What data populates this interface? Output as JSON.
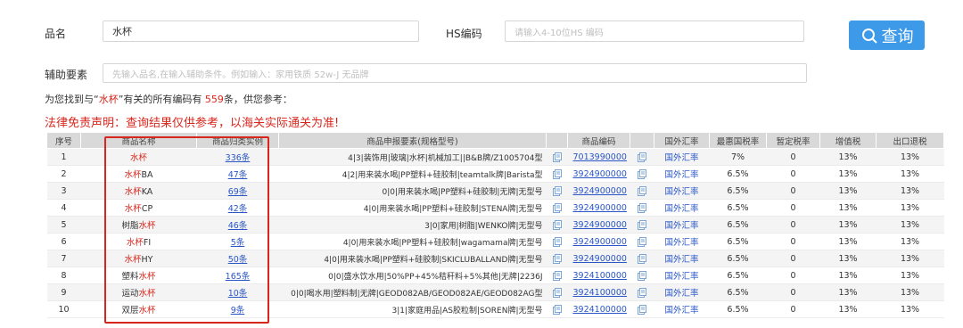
{
  "form": {
    "product_name_label": "品名",
    "product_name_value": "水杯",
    "hs_label": "HS编码",
    "hs_placeholder": "请输入4-10位HS 编码",
    "aux_label": "辅助要素",
    "aux_placeholder": "先输入品名,在输入辅助条件。例如输入：家用铁质 52w-J 无品牌",
    "search_label": "查询"
  },
  "result": {
    "prefix": "为您找到与“",
    "keyword": "水杯",
    "middle": "”有关的所有编码有",
    "count": "559",
    "suffix": "条，供您参考：",
    "disclaimer": "法律免责声明：查询结果仅供参考，以海关实际通关为准!"
  },
  "table": {
    "headers": [
      "序号",
      "商品名称",
      "商品归类实例",
      "商品申报要素(规格型号)",
      "",
      "商品编码",
      "",
      "国外汇率",
      "最惠国税率",
      "暂定税率",
      "增值税",
      "出口退税"
    ],
    "rows": [
      {
        "no": "1",
        "name_pre": "",
        "name_hl": "水杯",
        "name_post": "",
        "cases": "336条",
        "elements": "4|3|装饰用|玻璃|水杯|机械加工||B&B牌/Z1005704型",
        "code": "7013990000",
        "rate_link": "国外汇率",
        "mfn": "7%",
        "provisional": "0",
        "vat": "13%",
        "rebate": "13%"
      },
      {
        "no": "2",
        "name_pre": "",
        "name_hl": "水杯",
        "name_post": "BA",
        "cases": "47条",
        "elements": "4|2|用来装水喝|PP塑料+硅胶制|teamtalk牌|Barista型",
        "code": "3924900000",
        "rate_link": "国外汇率",
        "mfn": "6.5%",
        "provisional": "0",
        "vat": "13%",
        "rebate": "13%"
      },
      {
        "no": "3",
        "name_pre": "",
        "name_hl": "水杯",
        "name_post": "KA",
        "cases": "69条",
        "elements": "0|0|用来装水喝|PP塑料+硅胶制|无牌|无型号",
        "code": "3924900000",
        "rate_link": "国外汇率",
        "mfn": "6.5%",
        "provisional": "0",
        "vat": "13%",
        "rebate": "13%"
      },
      {
        "no": "4",
        "name_pre": "",
        "name_hl": "水杯",
        "name_post": "CP",
        "cases": "42条",
        "elements": "4|0|用来装水喝|PP塑料+硅胶制|STENA牌|无型号",
        "code": "3924900000",
        "rate_link": "国外汇率",
        "mfn": "6.5%",
        "provisional": "0",
        "vat": "13%",
        "rebate": "13%"
      },
      {
        "no": "5",
        "name_pre": "树脂",
        "name_hl": "水杯",
        "name_post": "",
        "cases": "46条",
        "elements": "3|0|家用|树脂|WENKO牌|无型号",
        "code": "3924900000",
        "rate_link": "国外汇率",
        "mfn": "6.5%",
        "provisional": "0",
        "vat": "13%",
        "rebate": "13%"
      },
      {
        "no": "6",
        "name_pre": "",
        "name_hl": "水杯",
        "name_post": "FI",
        "cases": "5条",
        "elements": "4|0|用来装水喝|PP塑料+硅胶制|wagamama牌|无型号",
        "code": "3924900000",
        "rate_link": "国外汇率",
        "mfn": "6.5%",
        "provisional": "0",
        "vat": "13%",
        "rebate": "13%"
      },
      {
        "no": "7",
        "name_pre": "",
        "name_hl": "水杯",
        "name_post": "HY",
        "cases": "50条",
        "elements": "4|0|用来装水喝|PP塑料+硅胶制|SKICLUBALLAND牌|无型号",
        "code": "3924900000",
        "rate_link": "国外汇率",
        "mfn": "6.5%",
        "provisional": "0",
        "vat": "13%",
        "rebate": "13%"
      },
      {
        "no": "8",
        "name_pre": "塑料",
        "name_hl": "水杯",
        "name_post": "",
        "cases": "165条",
        "elements": "0|0|盛水饮水用|50%PP+45%秸秆料+5%其他|无牌|2236J",
        "code": "3924100000",
        "rate_link": "国外汇率",
        "mfn": "6.5%",
        "provisional": "0",
        "vat": "13%",
        "rebate": "13%"
      },
      {
        "no": "9",
        "name_pre": "运动",
        "name_hl": "水杯",
        "name_post": "",
        "cases": "10条",
        "elements": "0|0|喝水用|塑料制|无牌|GEOD082AB/GEOD082AE/GEOD082AG型",
        "code": "3924100000",
        "rate_link": "国外汇率",
        "mfn": "6.5%",
        "provisional": "0",
        "vat": "13%",
        "rebate": "13%"
      },
      {
        "no": "10",
        "name_pre": "双层",
        "name_hl": "水杯",
        "name_post": "",
        "cases": "9条",
        "elements": "3|1|家庭用品|AS胶粒制|SOREN牌|无型号",
        "code": "3924100000",
        "rate_link": "国外汇率",
        "mfn": "6.5%",
        "provisional": "0",
        "vat": "13%",
        "rebate": "13%"
      }
    ]
  },
  "colors": {
    "accent_blue": "#3d9ae8",
    "highlight_red": "#d9261c",
    "link_blue": "#2a56c6"
  },
  "icons": {
    "search": "search-icon",
    "copy": "copy-icon"
  }
}
